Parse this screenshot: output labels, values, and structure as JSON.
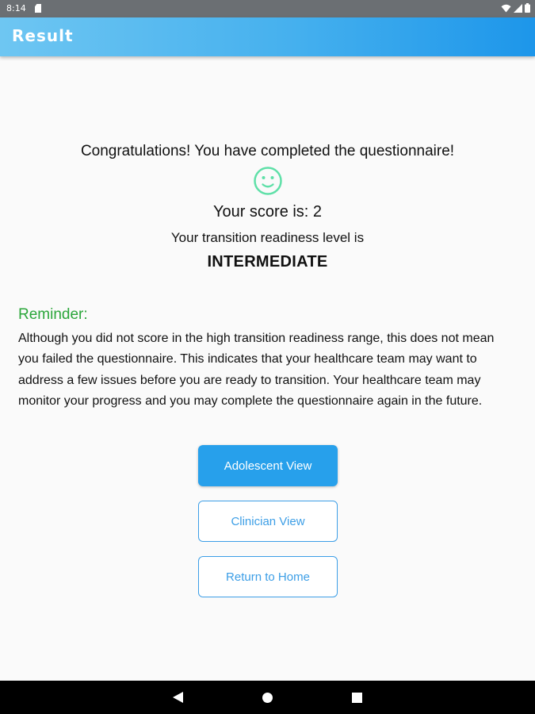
{
  "status_bar": {
    "time": "8:14",
    "icons": [
      "sim-card-icon",
      "wifi-icon",
      "signal-icon",
      "battery-icon"
    ]
  },
  "app_bar": {
    "title": "Result"
  },
  "result": {
    "congrats": "Congratulations! You have completed the questionnaire!",
    "score_text": "Your score is: 2",
    "readiness_text": "Your transition readiness level is",
    "readiness_level": "INTERMEDIATE"
  },
  "reminder": {
    "title": "Reminder:",
    "body": "Although you did not score in the high transition readiness range, this does not mean you failed the questionnaire. This indicates that your healthcare team may want to address a few issues before you are ready to transition. Your healthcare team may monitor your progress and you may complete the questionnaire again in the future."
  },
  "buttons": {
    "adolescent": "Adolescent View",
    "clinician": "Clinician View",
    "home": "Return to Home"
  },
  "colors": {
    "primary": "#27a0eb",
    "reminder_green": "#2aa63a",
    "smiley_green": "#5fe0a8"
  },
  "nav_bar": {
    "icons": [
      "back-icon",
      "home-icon",
      "recent-apps-icon"
    ]
  }
}
